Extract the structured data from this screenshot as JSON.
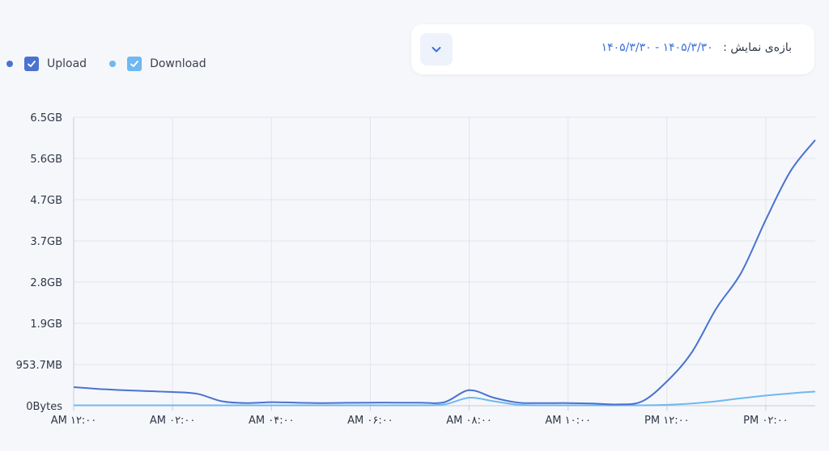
{
  "legend": {
    "items": [
      {
        "label": "Upload",
        "color": "#4a72d0"
      },
      {
        "label": "Download",
        "color": "#6fb8f0"
      }
    ]
  },
  "range": {
    "label": "بازه‌ی نمایش :",
    "value": "۱۴۰۵/۳/۳۰ - ۱۴۰۵/۳/۳۰"
  },
  "chart_data": {
    "type": "line",
    "title": "",
    "xlabel": "",
    "ylabel": "",
    "x": [
      0,
      0.5,
      1,
      1.5,
      2,
      2.5,
      3,
      3.5,
      4,
      4.5,
      5,
      5.5,
      6,
      6.5,
      7,
      7.5,
      8,
      8.5,
      9,
      9.5,
      10,
      10.5,
      11,
      11.5,
      12,
      12.5,
      13,
      13.5,
      14,
      14.5,
      15
    ],
    "x_ticks": [
      0,
      2,
      4,
      6,
      8,
      10,
      12,
      14
    ],
    "x_tick_labels": [
      "AM ۱۲:۰۰",
      "AM ۰۲:۰۰",
      "AM ۰۴:۰۰",
      "AM ۰۶:۰۰",
      "AM ۰۸:۰۰",
      "AM ۱۰:۰۰",
      "PM ۱۲:۰۰",
      "PM ۰۲:۰۰"
    ],
    "xlim": [
      0,
      15
    ],
    "y_unit": "GB",
    "y_ticks": [
      0,
      0.931,
      1.862,
      2.793,
      3.724,
      4.655,
      5.586,
      6.517
    ],
    "y_tick_labels": [
      "0Bytes",
      "953.7MB",
      "1.9GB",
      "2.8GB",
      "3.7GB",
      "4.7GB",
      "5.6GB",
      "6.5GB"
    ],
    "ylim": [
      0,
      6.517
    ],
    "grid": true,
    "series": [
      {
        "name": "Upload",
        "color": "#4a72d0",
        "values": [
          0.42,
          0.38,
          0.35,
          0.33,
          0.31,
          0.27,
          0.1,
          0.06,
          0.08,
          0.07,
          0.06,
          0.065,
          0.07,
          0.07,
          0.07,
          0.08,
          0.35,
          0.18,
          0.07,
          0.06,
          0.06,
          0.05,
          0.03,
          0.1,
          0.55,
          1.2,
          2.2,
          3.0,
          4.2,
          5.3,
          6.0
        ]
      },
      {
        "name": "Download",
        "color": "#6fb8f0",
        "values": [
          0.01,
          0.01,
          0.01,
          0.01,
          0.01,
          0.01,
          0.01,
          0.01,
          0.01,
          0.01,
          0.01,
          0.01,
          0.01,
          0.01,
          0.01,
          0.03,
          0.18,
          0.1,
          0.02,
          0.01,
          0.01,
          0.01,
          0.01,
          0.01,
          0.02,
          0.05,
          0.1,
          0.17,
          0.23,
          0.28,
          0.32
        ]
      }
    ]
  }
}
